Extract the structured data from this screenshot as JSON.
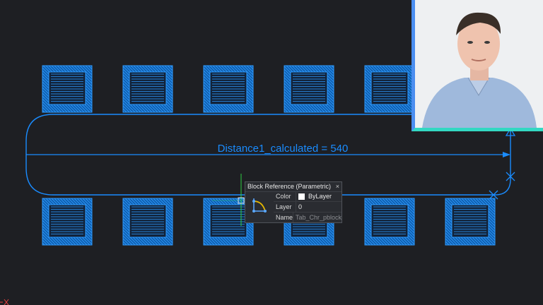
{
  "drawing": {
    "dimension_label": "Distance1_calculated = 540",
    "line_color": "#1a8cff"
  },
  "tooltip": {
    "title": "Block Reference (Parametric)",
    "close_glyph": "×",
    "icon": "block-parametric-icon",
    "properties": [
      {
        "key": "Color",
        "value": "ByLayer",
        "swatch": "#ffffff"
      },
      {
        "key": "Layer",
        "value": "0"
      },
      {
        "key": "Name",
        "value": "Tab_Chr_pblock"
      }
    ]
  },
  "webcam": {
    "icon": "presenter-video-icon",
    "border_colors": [
      "#4b8ef0",
      "#33d8c2"
    ]
  },
  "ucs": {
    "icon": "ucs-origin-icon",
    "color": "#e84040"
  }
}
